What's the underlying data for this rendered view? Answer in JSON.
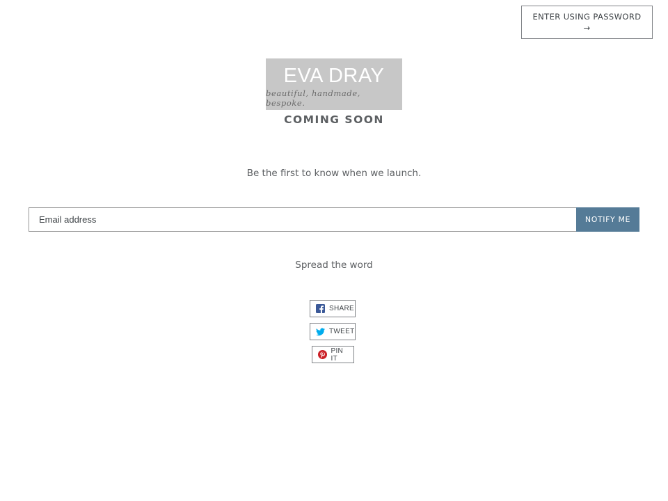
{
  "header": {
    "password_button_line1": "ENTER USING PASSWORD",
    "password_button_arrow": "→"
  },
  "logo": {
    "name": "EVA DRAY",
    "tagline": "beautiful, handmade, bespoke."
  },
  "main": {
    "heading": "COMING SOON",
    "launch_text": "Be the first to know when we launch."
  },
  "signup": {
    "email_placeholder": "Email address",
    "notify_label": "NOTIFY ME"
  },
  "social": {
    "heading": "Spread the word",
    "share_label": "SHARE",
    "tweet_label": "TWEET",
    "pin_label": "PIN IT",
    "icons": [
      "facebook-icon",
      "twitter-icon",
      "pinterest-icon"
    ]
  },
  "colors": {
    "accent": "#557b97",
    "logo_background": "#c7c7c7",
    "facebook": "#3b5998",
    "twitter": "#00aced",
    "pinterest": "#cb2027"
  }
}
